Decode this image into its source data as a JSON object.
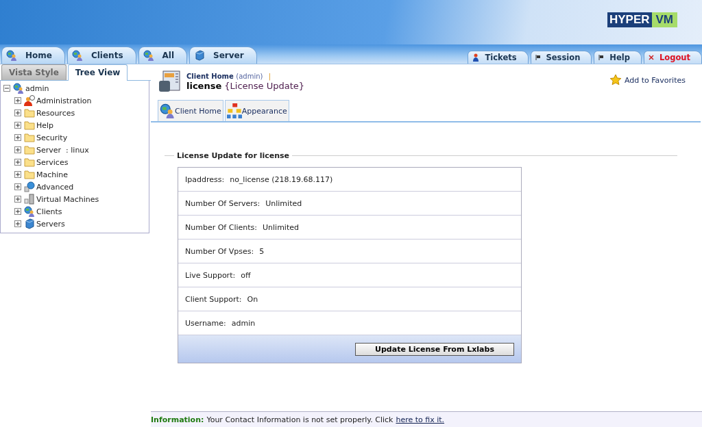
{
  "logo": {
    "left": "HYPER",
    "right": "VM"
  },
  "main_tabs": [
    {
      "label": "Home",
      "kind": "globe",
      "selected": false
    },
    {
      "label": "Clients",
      "kind": "globe",
      "selected": false
    },
    {
      "label": "All",
      "kind": "globe",
      "selected": false
    },
    {
      "label": "Server",
      "kind": "server",
      "selected": false
    }
  ],
  "right_tabs": [
    {
      "label": "Tickets",
      "kind": "ticket"
    },
    {
      "label": "Session",
      "kind": "flag"
    },
    {
      "label": "Help",
      "kind": "flag"
    },
    {
      "label": "Logout",
      "kind": "close"
    }
  ],
  "side_tabs": [
    {
      "label": "Vista Style",
      "selected": false
    },
    {
      "label": "Tree View",
      "selected": true
    }
  ],
  "tree": {
    "label": "admin",
    "kind": "globe",
    "expanded": true,
    "children": [
      {
        "label": "Administration",
        "kind": "user",
        "expanded": false
      },
      {
        "label": "Resources",
        "kind": "folder",
        "expanded": false
      },
      {
        "label": "Help",
        "kind": "folder",
        "expanded": false
      },
      {
        "label": "Security",
        "kind": "folder",
        "expanded": false
      },
      {
        "label": "Server  : linux",
        "kind": "folder",
        "expanded": false
      },
      {
        "label": "Services",
        "kind": "folder",
        "expanded": false
      },
      {
        "label": "Machine",
        "kind": "folder",
        "expanded": false
      },
      {
        "label": "Advanced",
        "kind": "network",
        "expanded": false
      },
      {
        "label": "Virtual Machines",
        "kind": "vm",
        "expanded": false
      },
      {
        "label": "Clients",
        "kind": "globe",
        "expanded": false
      },
      {
        "label": "Servers",
        "kind": "server",
        "expanded": false
      }
    ]
  },
  "page_header": {
    "breadcrumb": "Client Home",
    "breadcrumb_user": "(admin)",
    "separator": "|",
    "title": "license",
    "subtitle": "{License Update}"
  },
  "favorites": "Add to Favorites",
  "sub_tabs": [
    {
      "label": "Client Home",
      "kind": "globe"
    },
    {
      "label": "Appearance",
      "kind": "blocks"
    }
  ],
  "form": {
    "legend": "License Update for license",
    "rows": [
      {
        "label": "Ipaddress:",
        "value": "no_license (218.19.68.117)"
      },
      {
        "label": "Number Of Servers:",
        "value": "Unlimited"
      },
      {
        "label": "Number Of Clients:",
        "value": "Unlimited"
      },
      {
        "label": "Number Of Vpses:",
        "value": "5"
      },
      {
        "label": "Live Support:",
        "value": "off"
      },
      {
        "label": "Client Support:",
        "value": "On"
      },
      {
        "label": "Username:",
        "value": "admin"
      }
    ],
    "button": "Update License From Lxlabs"
  },
  "info_bar": {
    "label": "Information:",
    "text": "Your Contact Information is not set properly. Click",
    "link": "here to fix it."
  }
}
